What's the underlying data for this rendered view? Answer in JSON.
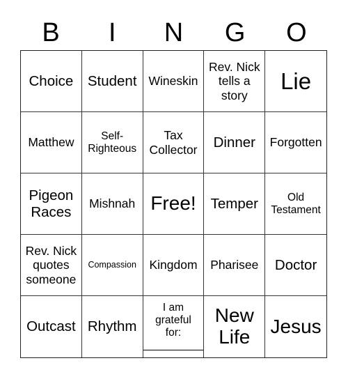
{
  "card": {
    "header": [
      "B",
      "I",
      "N",
      "G",
      "O"
    ],
    "rows": [
      [
        {
          "text": "Choice",
          "size": "l"
        },
        {
          "text": "Student",
          "size": "l"
        },
        {
          "text": "Wineskin",
          "size": "m"
        },
        {
          "text": "Rev. Nick\ntells a\nstory",
          "size": "m"
        },
        {
          "text": "Lie",
          "size": "xxl"
        }
      ],
      [
        {
          "text": "Matthew",
          "size": "m"
        },
        {
          "text": "Self-\nRighteous",
          "size": "s"
        },
        {
          "text": "Tax\nCollector",
          "size": "m"
        },
        {
          "text": "Dinner",
          "size": "l"
        },
        {
          "text": "Forgotten",
          "size": "m"
        }
      ],
      [
        {
          "text": "Pigeon\nRaces",
          "size": "l"
        },
        {
          "text": "Mishnah",
          "size": "m"
        },
        {
          "text": "Free!",
          "size": "xl"
        },
        {
          "text": "Temper",
          "size": "l"
        },
        {
          "text": "Old\nTestament",
          "size": "s"
        }
      ],
      [
        {
          "text": "Rev. Nick\nquotes\nsomeone",
          "size": "m"
        },
        {
          "text": "Compassion",
          "size": "xs"
        },
        {
          "text": "Kingdom",
          "size": "m"
        },
        {
          "text": "Pharisee",
          "size": "m"
        },
        {
          "text": "Doctor",
          "size": "l"
        }
      ],
      [
        {
          "text": "Outcast",
          "size": "l"
        },
        {
          "text": "Rhythm",
          "size": "l"
        },
        {
          "text": "I am\ngrateful\nfor:\n__________",
          "size": "s"
        },
        {
          "text": "New\nLife",
          "size": "xl"
        },
        {
          "text": "Jesus",
          "size": "xl"
        }
      ]
    ]
  }
}
